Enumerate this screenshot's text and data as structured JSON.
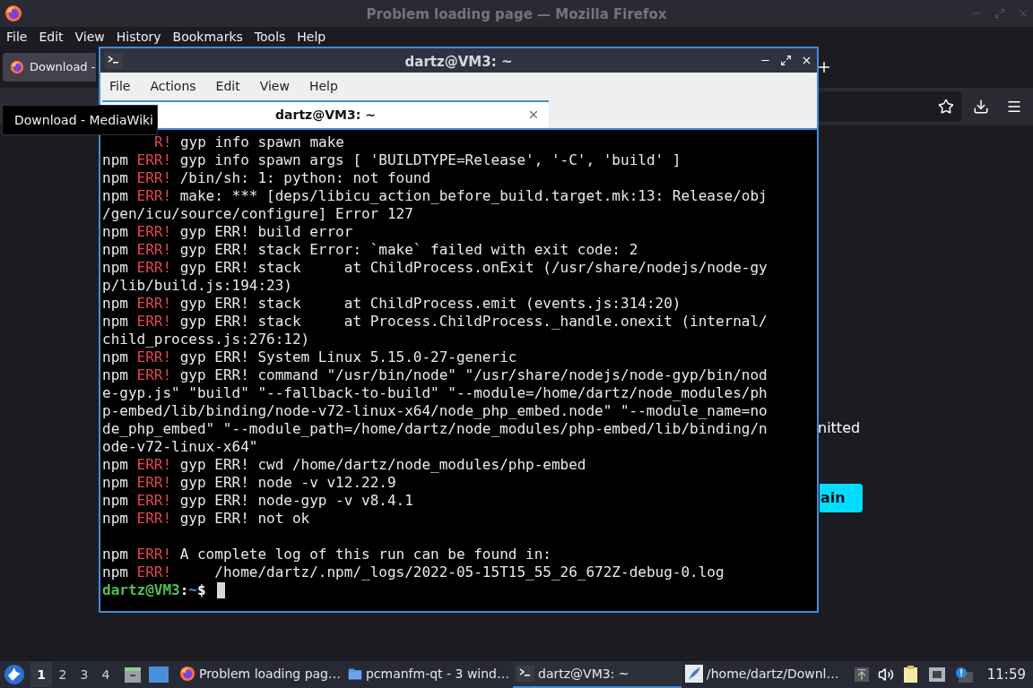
{
  "firefox": {
    "title": "Problem loading page — Mozilla Firefox",
    "menu": [
      "File",
      "Edit",
      "View",
      "History",
      "Bookmarks",
      "Tools",
      "Help"
    ],
    "tabs": [
      {
        "label": "Download -",
        "selected": true
      }
    ],
    "tooltip": "Download - MediaWiki",
    "page": {
      "text": "nitted",
      "button": "ain"
    }
  },
  "terminal": {
    "title": "dartz@VM3: ~",
    "menu": [
      "File",
      "Actions",
      "Edit",
      "View",
      "Help"
    ],
    "tabs": [
      {
        "label": "dartz@VM3: ~",
        "selected": true
      }
    ],
    "lines": [
      {
        "kind": "cut",
        "tag": "R!",
        "text": "gyp info spawn make"
      },
      {
        "kind": "err",
        "npm": "npm",
        "tag": "ERR!",
        "text": "gyp info spawn args [ 'BUILDTYPE=Release', '-C', 'build' ]"
      },
      {
        "kind": "err",
        "npm": "npm",
        "tag": "ERR!",
        "text": "/bin/sh: 1: python: not found"
      },
      {
        "kind": "err",
        "npm": "npm",
        "tag": "ERR!",
        "text": "make: *** [deps/libicu_action_before_build.target.mk:13: Release/obj"
      },
      {
        "kind": "plain",
        "text": "/gen/icu/source/configure] Error 127"
      },
      {
        "kind": "err",
        "npm": "npm",
        "tag": "ERR!",
        "text": "gyp ERR! build error"
      },
      {
        "kind": "err",
        "npm": "npm",
        "tag": "ERR!",
        "text": "gyp ERR! stack Error: `make` failed with exit code: 2"
      },
      {
        "kind": "err",
        "npm": "npm",
        "tag": "ERR!",
        "text": "gyp ERR! stack     at ChildProcess.onExit (/usr/share/nodejs/node-gy"
      },
      {
        "kind": "plain",
        "text": "p/lib/build.js:194:23)"
      },
      {
        "kind": "err",
        "npm": "npm",
        "tag": "ERR!",
        "text": "gyp ERR! stack     at ChildProcess.emit (events.js:314:20)"
      },
      {
        "kind": "err",
        "npm": "npm",
        "tag": "ERR!",
        "text": "gyp ERR! stack     at Process.ChildProcess._handle.onexit (internal/"
      },
      {
        "kind": "plain",
        "text": "child_process.js:276:12)"
      },
      {
        "kind": "err",
        "npm": "npm",
        "tag": "ERR!",
        "text": "gyp ERR! System Linux 5.15.0-27-generic"
      },
      {
        "kind": "err",
        "npm": "npm",
        "tag": "ERR!",
        "text": "gyp ERR! command \"/usr/bin/node\" \"/usr/share/nodejs/node-gyp/bin/nod"
      },
      {
        "kind": "plain",
        "text": "e-gyp.js\" \"build\" \"--fallback-to-build\" \"--module=/home/dartz/node_modules/ph"
      },
      {
        "kind": "plain",
        "text": "p-embed/lib/binding/node-v72-linux-x64/node_php_embed.node\" \"--module_name=no"
      },
      {
        "kind": "plain",
        "text": "de_php_embed\" \"--module_path=/home/dartz/node_modules/php-embed/lib/binding/n"
      },
      {
        "kind": "plain",
        "text": "ode-v72-linux-x64\""
      },
      {
        "kind": "err",
        "npm": "npm",
        "tag": "ERR!",
        "text": "gyp ERR! cwd /home/dartz/node_modules/php-embed"
      },
      {
        "kind": "err",
        "npm": "npm",
        "tag": "ERR!",
        "text": "gyp ERR! node -v v12.22.9"
      },
      {
        "kind": "err",
        "npm": "npm",
        "tag": "ERR!",
        "text": "gyp ERR! node-gyp -v v8.4.1"
      },
      {
        "kind": "err",
        "npm": "npm",
        "tag": "ERR!",
        "text": "gyp ERR! not ok"
      },
      {
        "kind": "blank"
      },
      {
        "kind": "err",
        "npm": "npm",
        "tag": "ERR!",
        "text": "A complete log of this run can be found in:"
      },
      {
        "kind": "err",
        "npm": "npm",
        "tag": "ERR!",
        "text": "    /home/dartz/.npm/_logs/2022-05-15T15_55_26_672Z-debug-0.log"
      }
    ],
    "prompt": {
      "user": "dartz@VM3",
      "sep": ":",
      "path": "~",
      "symbol": "$"
    }
  },
  "taskbar": {
    "desktops": [
      {
        "label": "1",
        "selected": true
      },
      {
        "label": "2",
        "selected": false
      },
      {
        "label": "3",
        "selected": false
      },
      {
        "label": "4",
        "selected": false
      }
    ],
    "tasks": [
      {
        "kind": "firefox",
        "label": "Problem loading pag…",
        "selected": false
      },
      {
        "kind": "folder",
        "label": "pcmanfm-qt - 3 wind…",
        "selected": false
      },
      {
        "kind": "terminal",
        "label": "dartz@VM3: ~",
        "selected": true
      },
      {
        "kind": "editor",
        "label": "/home/dartz/Downl…",
        "selected": false
      }
    ],
    "clock": "11:59"
  }
}
